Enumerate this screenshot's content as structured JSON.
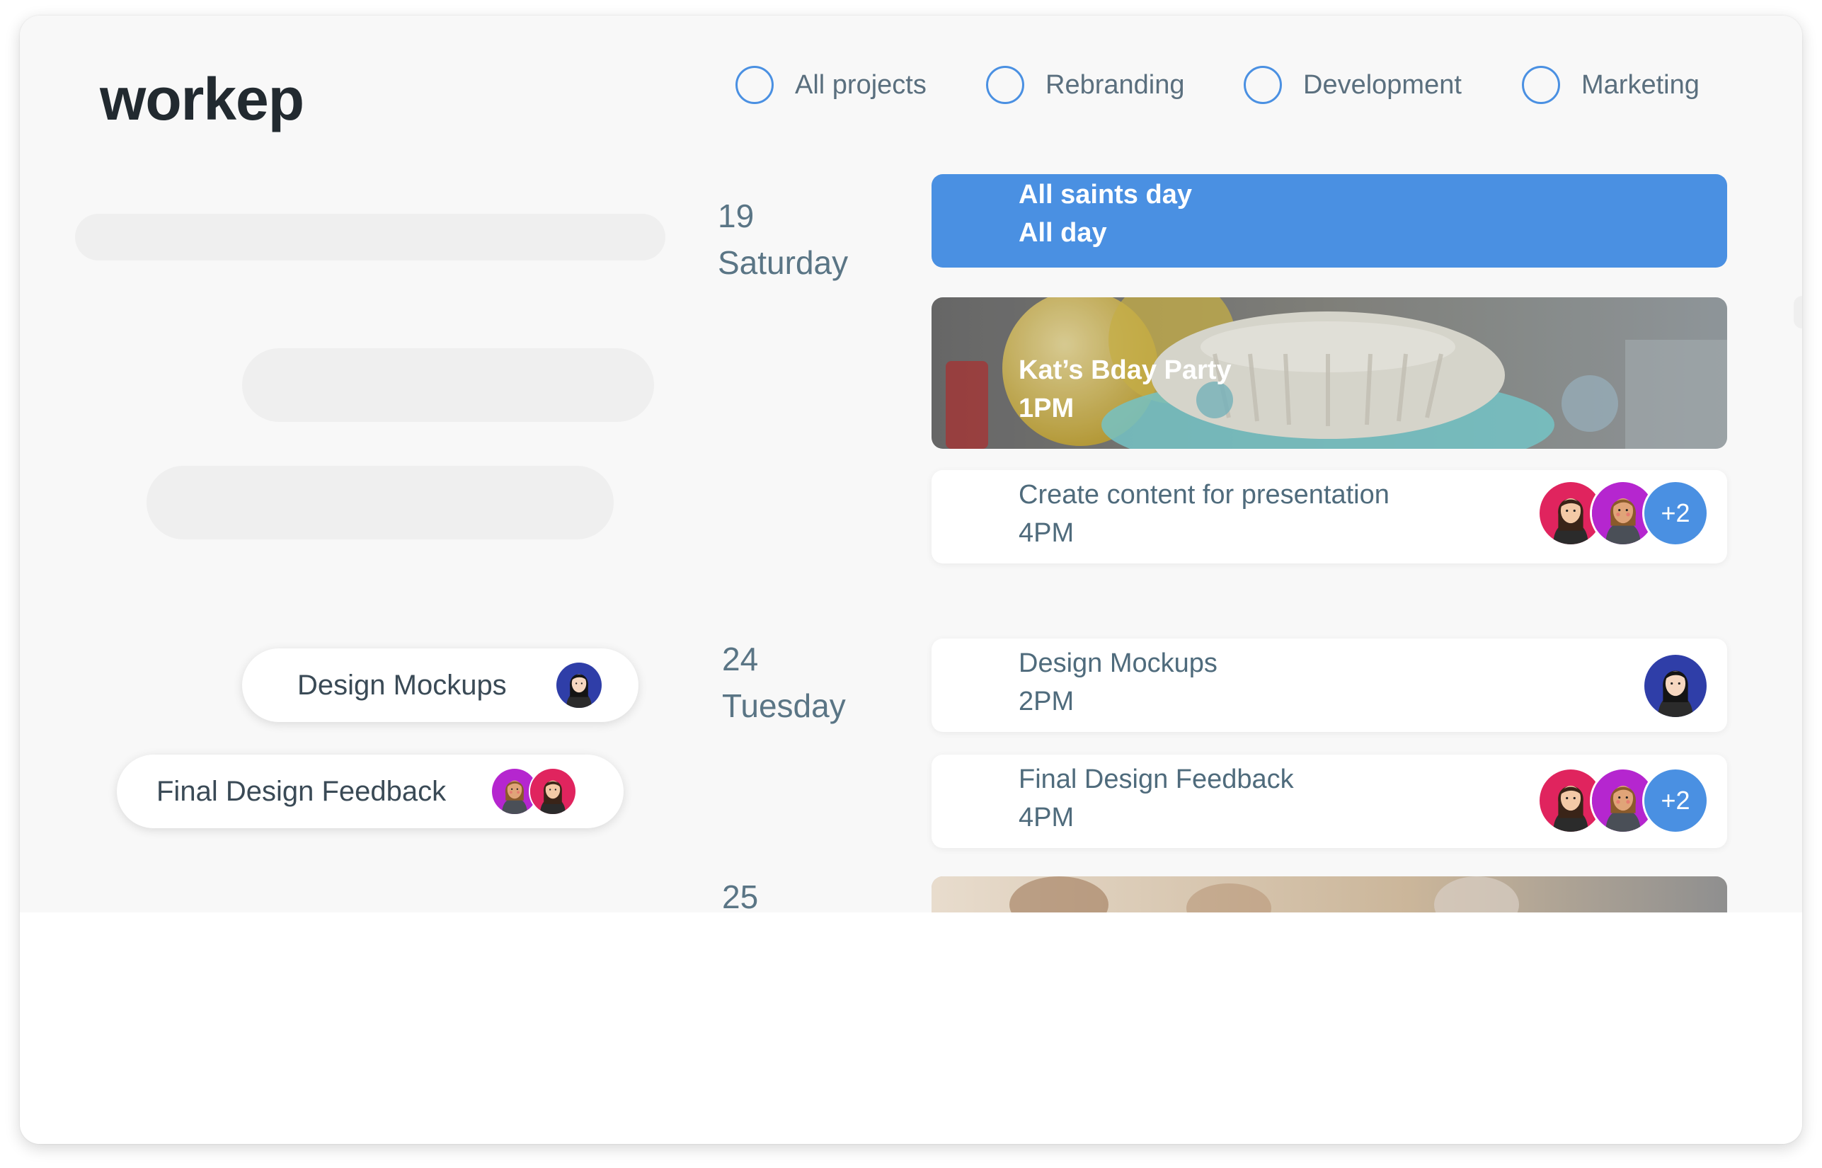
{
  "app": {
    "name": "workep"
  },
  "filters": [
    {
      "label": "All projects"
    },
    {
      "label": "Rebranding"
    },
    {
      "label": "Development"
    },
    {
      "label": "Marketing"
    }
  ],
  "sidebar": {
    "pills": [
      {
        "label": "Design Mockups"
      },
      {
        "label": "Final Design Feedback"
      }
    ]
  },
  "days": [
    {
      "number": "19",
      "weekday": "Saturday"
    },
    {
      "number": "24",
      "weekday": "Tuesday"
    },
    {
      "number": "25",
      "weekday": ""
    }
  ],
  "events": [
    {
      "title": "All saints day",
      "time": "All day",
      "style": "blue"
    },
    {
      "title": "Kat’s Bday Party",
      "time": "1PM",
      "style": "photo"
    },
    {
      "title": "Create content for presentation",
      "time": "4PM",
      "style": "white",
      "extra_members": "+2"
    },
    {
      "title": "Design Mockups",
      "time": "2PM",
      "style": "white"
    },
    {
      "title": "Final Design Feedback",
      "time": "4PM",
      "style": "white",
      "extra_members": "+2"
    }
  ],
  "colors": {
    "accent": "#4a90e2",
    "text_muted": "#5a7585",
    "avatar_pink": "#e0245e",
    "avatar_purple": "#b526cf",
    "avatar_navy": "#2f3ea8"
  },
  "icons": [
    "radio-circle-icon",
    "avatar-icon"
  ]
}
